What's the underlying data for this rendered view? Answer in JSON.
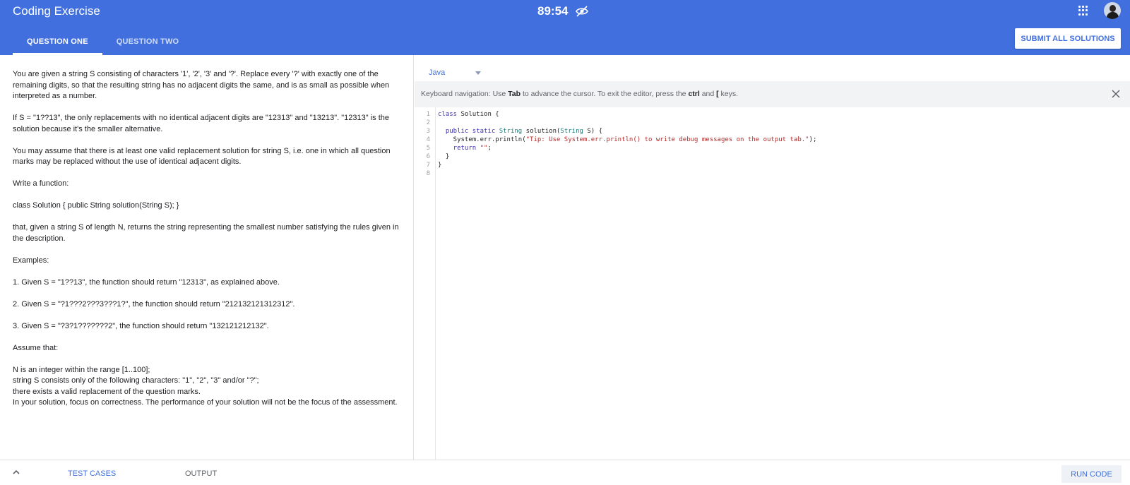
{
  "header": {
    "title": "Coding Exercise",
    "timer": "89:54",
    "tabs": [
      {
        "label": "QUESTION ONE"
      },
      {
        "label": "QUESTION TWO"
      }
    ],
    "submit_label": "SUBMIT ALL SOLUTIONS",
    "accent_color": "#4170de"
  },
  "problem": {
    "paragraphs": [
      "You are given a string S consisting of characters '1', '2', '3' and '?'. Replace every '?' with exactly one of the remaining digits, so that the resulting string has no adjacent digits the same, and is as small as possible when interpreted as a number.",
      "If S = \"1??13\", the only replacements with no identical adjacent digits are \"12313\" and \"13213\". \"12313\" is the solution because it's the smaller alternative.",
      "You may assume that there is at least one valid replacement solution for string S, i.e. one in which all question marks may be replaced without the use of identical adjacent digits.",
      "Write a function:",
      "class Solution { public String solution(String S); }",
      "that, given a string S of length N, returns the string representing the smallest number satisfying the rules given in the description.",
      "Examples:",
      "1. Given S = \"1??13\", the function should return \"12313\", as explained above.",
      "2. Given S = \"?1???2???3???1?\", the function should return \"212132121312312\".",
      "3. Given S = \"?3?1???????2\", the function should return \"132121212132\".",
      "Assume that:"
    ],
    "assumptions": [
      "N is an integer within the range [1..100];",
      "string S consists only of the following characters: \"1\", \"2\", \"3\" and/or \"?\";",
      "there exists a valid replacement of the question marks.",
      "In your solution, focus on correctness. The performance of your solution will not be the focus of the assessment."
    ]
  },
  "editor": {
    "language": "Java",
    "keyboard_nav": {
      "prefix": "Keyboard navigation: Use ",
      "tab_key": "Tab",
      "middle": " to advance the cursor. To exit the editor, press the ",
      "ctrl_key": "ctrl",
      "and": " and ",
      "bracket_key": "[",
      "suffix": " keys."
    },
    "line_numbers": [
      "1",
      "2",
      "3",
      "4",
      "5",
      "6",
      "7",
      "8"
    ],
    "code": {
      "l1_kw": "class",
      "l1_name": " Solution {",
      "l3_indent": "  ",
      "l3_kw": "public static",
      "l3_type": " String",
      "l3_sig": " solution(",
      "l3_ptype": "String",
      "l3_rest": " S) {",
      "l4_start": "    System.err.println(",
      "l4_str": "\"Tip: Use System.err.println() to write debug messages on the output tab.\"",
      "l4_end": ");",
      "l5_kw": "    return",
      "l5_str": " \"\"",
      "l5_end": ";",
      "l6": "  }",
      "l7": "}"
    }
  },
  "bottom": {
    "tests_label": "TEST CASES",
    "output_label": "OUTPUT",
    "run_label": "RUN CODE"
  }
}
